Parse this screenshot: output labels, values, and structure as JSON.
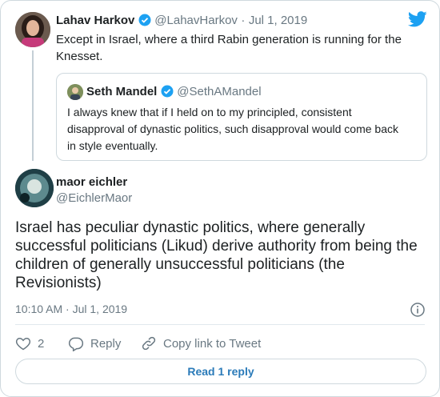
{
  "colors": {
    "twitter_blue": "#1da1f2",
    "link_blue": "#2b7bb9",
    "muted": "#697882",
    "border": "#cfd9de"
  },
  "icons": [
    "twitter-bird-icon",
    "verified-icon",
    "info-icon",
    "heart-icon",
    "reply-icon",
    "link-icon"
  ],
  "reply_tweet": {
    "author_name": "Lahav Harkov",
    "author_handle": "@LahavHarkov",
    "date_sep": "·",
    "date": "Jul 1, 2019",
    "text": "Except in Israel, where a third Rabin generation is running for the Knesset.",
    "quoted": {
      "author_name": "Seth Mandel",
      "author_handle": "@SethAMandel",
      "text": "I always knew that if I held on to my principled, consistent disapproval of dynastic politics, such disapproval would come back in style eventually."
    }
  },
  "main_tweet": {
    "author_name": "maor eichler",
    "author_handle": "@EichlerMaor",
    "text": "Israel has peculiar dynastic politics, where generally successful politicians (Likud) derive authority from being the children of generally unsuccessful politicians (the Revisionists)",
    "timestamp": "10:10 AM · Jul 1, 2019"
  },
  "actions": {
    "like_count": "2",
    "reply_label": "Reply",
    "copy_link_label": "Copy link to Tweet"
  },
  "read_replies_label": "Read 1 reply"
}
